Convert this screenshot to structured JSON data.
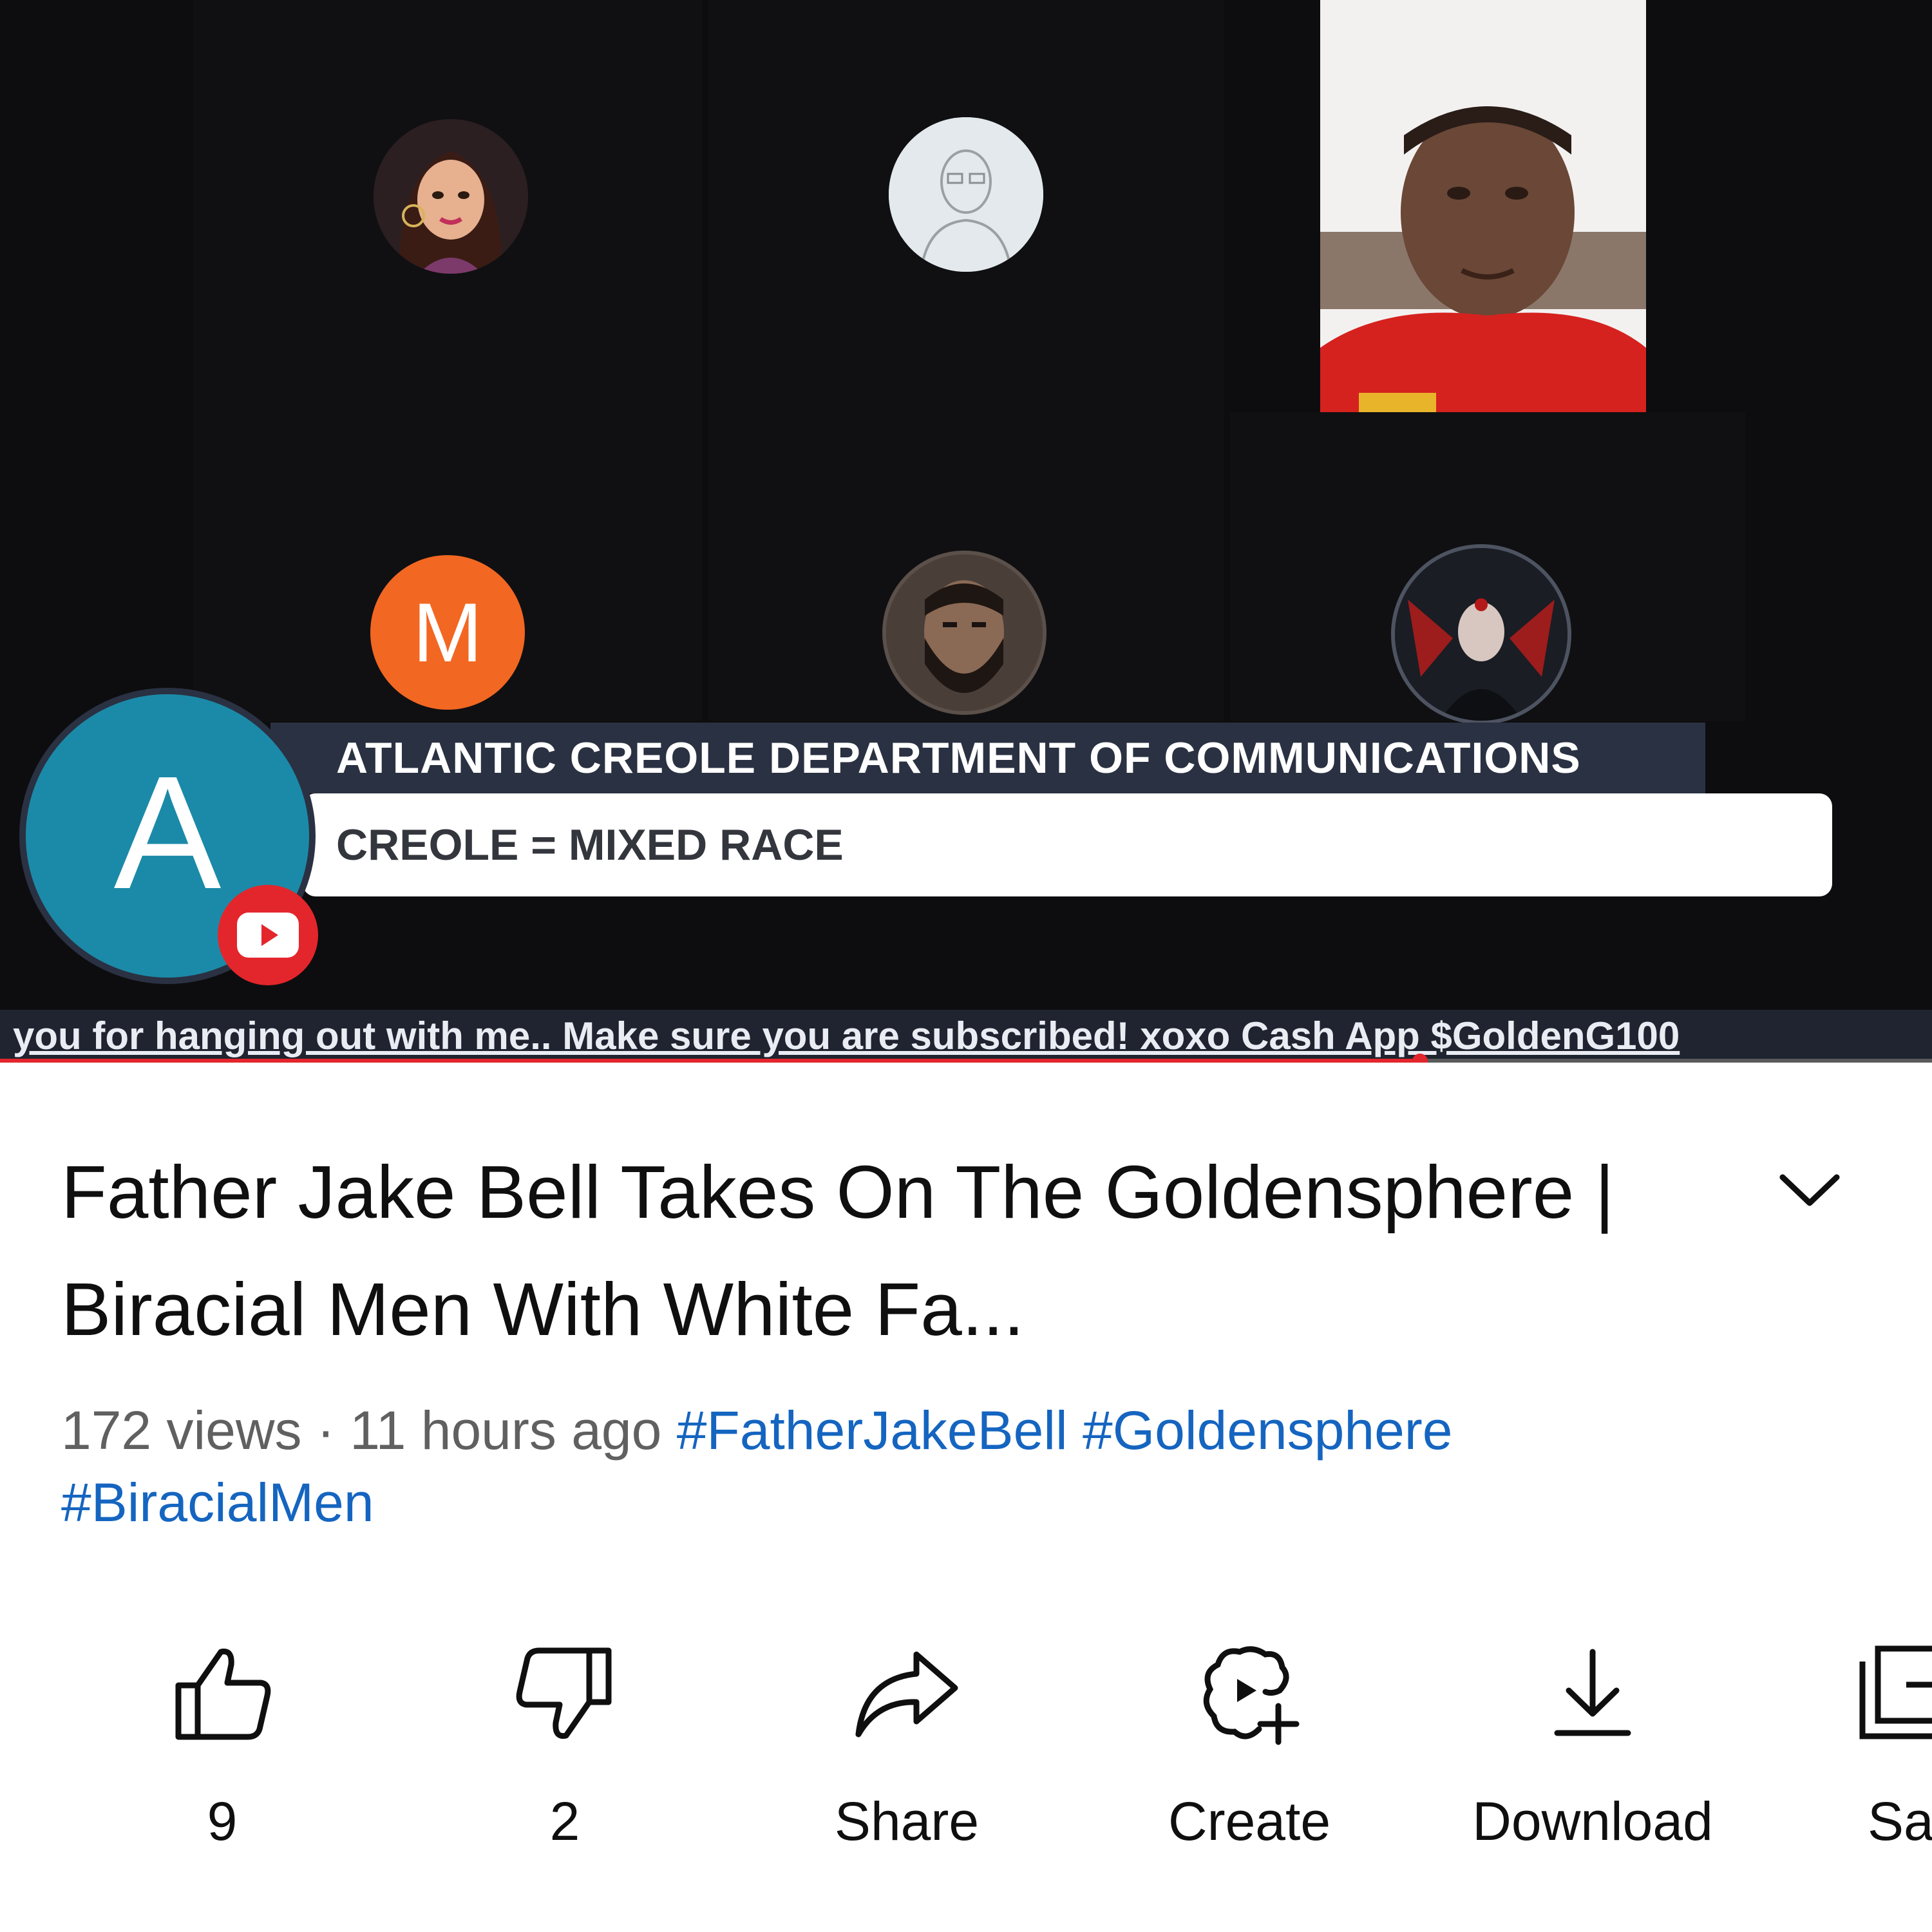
{
  "video": {
    "avatar_m_letter": "M",
    "host_letter": "A",
    "lower_third": {
      "title": "ATLANTIC CREOLE DEPARTMENT OF COMMUNICATIONS",
      "subtitle": "CREOLE = MIXED RACE"
    },
    "ticker": "you for hanging out with me.. Make sure you are subscribed! xoxo Cash App $GoldenG100",
    "progress": 0.735,
    "colors": {
      "background": "#0d0d0f",
      "avatar_m": "#f26722",
      "host_avatar": "#1b8aa8",
      "youtube_red": "#e3262c",
      "lower_third_bar": "#2a3142"
    }
  },
  "details": {
    "title": "Father Jake Bell Takes On The Goldensphere | Biracial Men With White Fa...",
    "views": "172 views",
    "separator": "·",
    "age": "11 hours ago",
    "hashtags": [
      "#FatherJakeBell",
      "#Goldensphere",
      "#BiracialMen"
    ],
    "expand_icon": "chevron-down-icon",
    "tag_color": "#1565c0"
  },
  "actions": [
    {
      "id": "like",
      "icon": "thumbs-up-icon",
      "label": "9"
    },
    {
      "id": "dislike",
      "icon": "thumbs-down-icon",
      "label": "2"
    },
    {
      "id": "share",
      "icon": "share-arrow-icon",
      "label": "Share"
    },
    {
      "id": "create",
      "icon": "create-sparkle-icon",
      "label": "Create"
    },
    {
      "id": "download",
      "icon": "download-icon",
      "label": "Download"
    },
    {
      "id": "save",
      "icon": "save-playlist-icon",
      "label": "Sa"
    }
  ]
}
